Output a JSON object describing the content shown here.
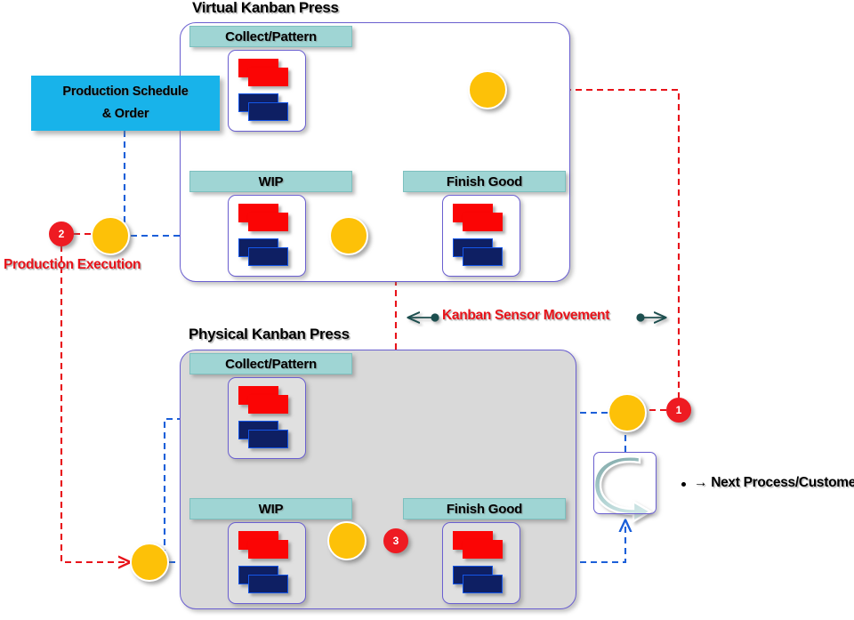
{
  "diagram": {
    "title_virtual": "Virtual Kanban Press",
    "title_physical": "Physical Kanban Press",
    "schedule_line1": "Production Schedule",
    "schedule_line2": "& Order",
    "production_execution": "Production Execution",
    "kanban_sensor_movement": "Kanban Sensor Movement",
    "next_process": "→ Next Process/Customer",
    "sections": {
      "collect_pattern": "Collect/Pattern",
      "wip": "WIP",
      "finish_good": "Finish Good"
    },
    "step_markers": {
      "one": "1",
      "two": "2",
      "three": "3"
    },
    "icons": {
      "cycle": "cycle-arrow-icon",
      "sensor_left": "arrow-left-dot-icon",
      "sensor_right": "dot-arrow-right-icon"
    },
    "colors": {
      "virtual_fill": "#ffffff",
      "physical_fill": "#d9d9d9",
      "box_border": "#6a5fd0",
      "section_header": "#9fd5d4",
      "schedule_fill": "#18b3ea",
      "card_red": "#fb0505",
      "card_navy": "#0e1f63",
      "node_yellow": "#fdc108",
      "node_red": "#ee1b22",
      "flow_blue": "#1b5fd9",
      "flow_red": "#e8131a",
      "sensor_arrow": "#1f4f4f"
    }
  }
}
